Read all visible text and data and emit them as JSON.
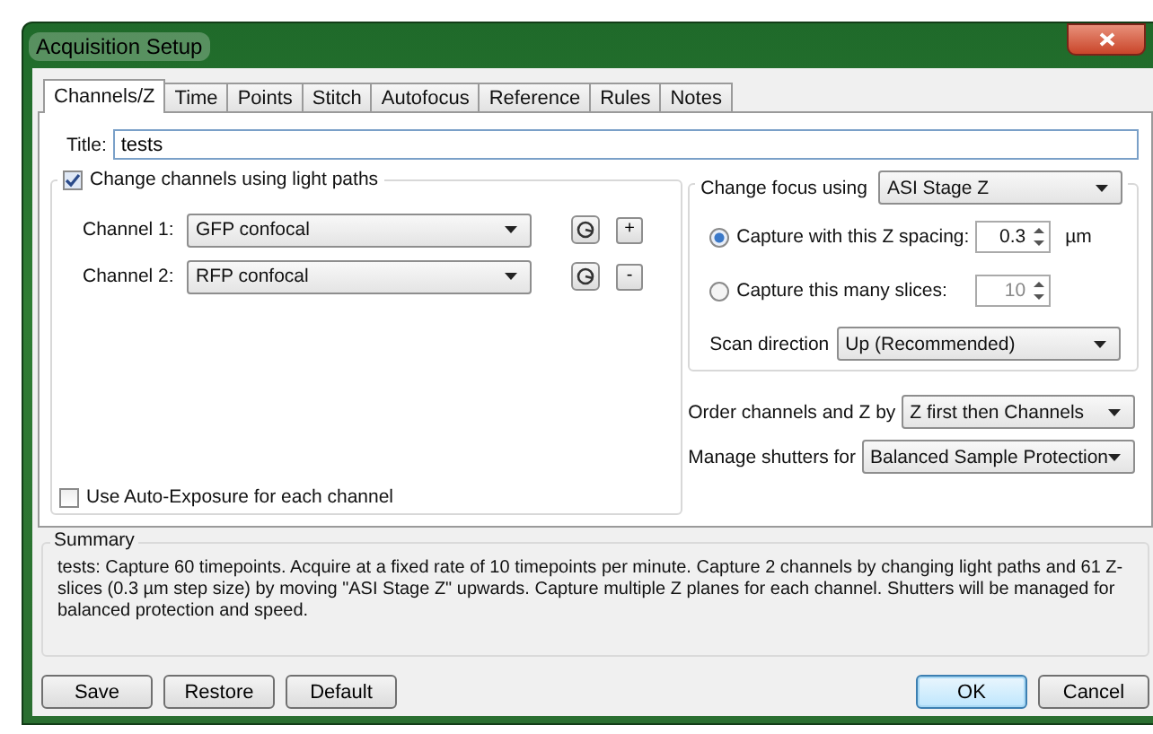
{
  "window": {
    "title": "Acquisition Setup"
  },
  "tabs": [
    {
      "label": "Channels/Z",
      "selected": true
    },
    {
      "label": "Time",
      "selected": false
    },
    {
      "label": "Points",
      "selected": false
    },
    {
      "label": "Stitch",
      "selected": false
    },
    {
      "label": "Autofocus",
      "selected": false
    },
    {
      "label": "Reference",
      "selected": false
    },
    {
      "label": "Rules",
      "selected": false
    },
    {
      "label": "Notes",
      "selected": false
    }
  ],
  "title_field": {
    "label": "Title:",
    "value": "tests"
  },
  "channels_group": {
    "label": "Change channels using light paths",
    "checked": true,
    "channels": [
      {
        "label": "Channel 1:",
        "value": "GFP confocal",
        "action": "+"
      },
      {
        "label": "Channel 2:",
        "value": "RFP confocal",
        "action": "-"
      }
    ],
    "auto_exposure": {
      "label": "Use Auto-Exposure for each channel",
      "checked": false
    }
  },
  "focus_group": {
    "label": "Change focus using",
    "value": "ASI Stage Z",
    "modes": [
      {
        "label": "Capture with this Z spacing:",
        "value": "0.3",
        "unit": "µm",
        "selected": true
      },
      {
        "label": "Capture this many slices:",
        "value": "10",
        "selected": false
      }
    ],
    "scan_direction": {
      "label": "Scan direction",
      "value": "Up (Recommended)"
    }
  },
  "order": {
    "label": "Order channels and Z by",
    "value": "Z first then Channels"
  },
  "shutters": {
    "label": "Manage shutters for",
    "value": "Balanced Sample Protection"
  },
  "summary": {
    "title": "Summary",
    "text": "tests: Capture 60 timepoints.  Acquire at a fixed rate of 10 timepoints per minute.  Capture 2 channels by changing light paths and 61 Z-slices (0.3 µm step size) by moving \"ASI Stage Z\" upwards.  Capture multiple Z planes for each channel.  Shutters will be managed for balanced protection and speed."
  },
  "left_buttons": [
    {
      "label": "Save",
      "default": false
    },
    {
      "label": "Restore",
      "default": false
    },
    {
      "label": "Default",
      "default": false
    }
  ],
  "right_buttons": [
    {
      "label": "OK",
      "default": true
    },
    {
      "label": "Cancel",
      "default": false
    }
  ]
}
